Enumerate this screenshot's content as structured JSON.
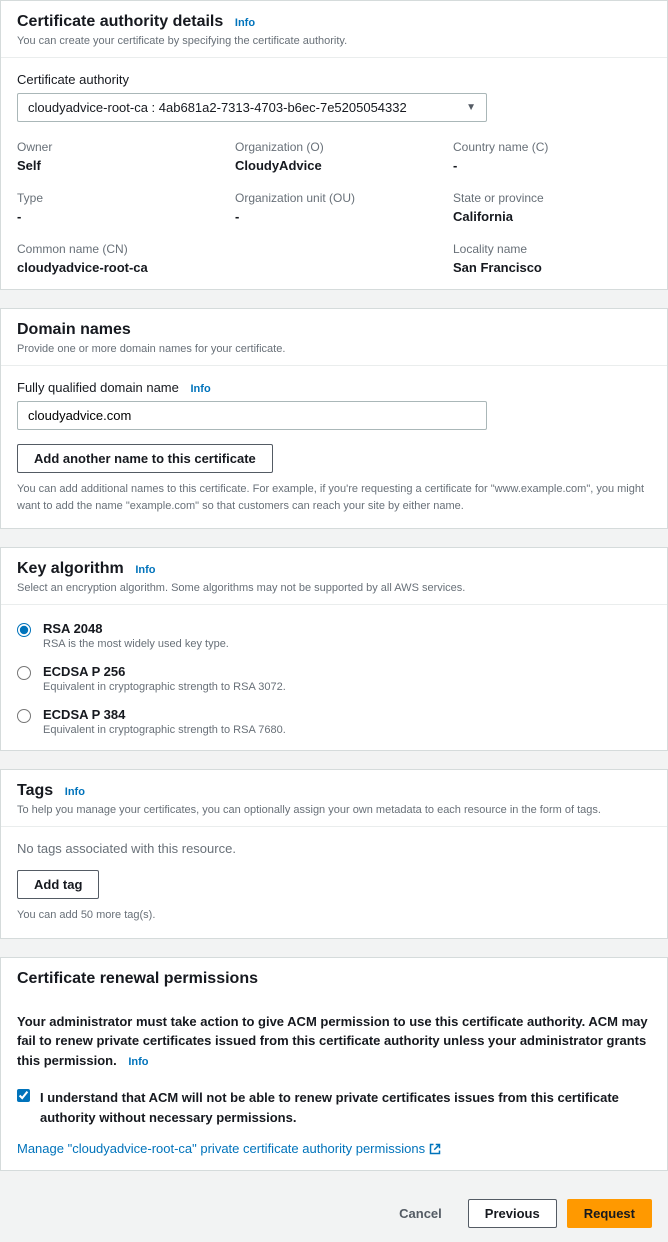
{
  "ca_details": {
    "title": "Certificate authority details",
    "info": "Info",
    "subtitle": "You can create your certificate by specifying the certificate authority.",
    "select_label": "Certificate authority",
    "select_value": "cloudyadvice-root-ca : 4ab681a2-7313-4703-b6ec-7e5205054332",
    "fields": {
      "owner_label": "Owner",
      "owner_value": "Self",
      "org_label": "Organization (O)",
      "org_value": "CloudyAdvice",
      "country_label": "Country name (C)",
      "country_value": "-",
      "type_label": "Type",
      "type_value": "-",
      "ou_label": "Organization unit (OU)",
      "ou_value": "-",
      "state_label": "State or province",
      "state_value": "California",
      "cn_label": "Common name (CN)",
      "cn_value": "cloudyadvice-root-ca",
      "locality_label": "Locality name",
      "locality_value": "San Francisco"
    }
  },
  "domain_names": {
    "title": "Domain names",
    "subtitle": "Provide one or more domain names for your certificate.",
    "fqdn_label": "Fully qualified domain name",
    "info": "Info",
    "fqdn_value": "cloudyadvice.com",
    "add_button": "Add another name to this certificate",
    "help": "You can add additional names to this certificate. For example, if you're requesting a certificate for \"www.example.com\", you might want to add the name \"example.com\" so that customers can reach your site by either name."
  },
  "key_algo": {
    "title": "Key algorithm",
    "info": "Info",
    "subtitle": "Select an encryption algorithm. Some algorithms may not be supported by all AWS services.",
    "options": [
      {
        "label": "RSA 2048",
        "desc": "RSA is the most widely used key type.",
        "checked": true
      },
      {
        "label": "ECDSA P 256",
        "desc": "Equivalent in cryptographic strength to RSA 3072.",
        "checked": false
      },
      {
        "label": "ECDSA P 384",
        "desc": "Equivalent in cryptographic strength to RSA 7680.",
        "checked": false
      }
    ]
  },
  "tags": {
    "title": "Tags",
    "info": "Info",
    "subtitle": "To help you manage your certificates, you can optionally assign your own metadata to each resource in the form of tags.",
    "empty": "No tags associated with this resource.",
    "add_button": "Add tag",
    "limit": "You can add 50 more tag(s)."
  },
  "renewal": {
    "title": "Certificate renewal permissions",
    "warning": "Your administrator must take action to give ACM permission to use this certificate authority. ACM may fail to renew private certificates issued from this certificate authority unless your administrator grants this permission.",
    "info": "Info",
    "checkbox_label": "I understand that ACM will not be able to renew private certificates issues from this certificate authority without necessary permissions.",
    "manage_link": "Manage \"cloudyadvice-root-ca\" private certificate authority permissions"
  },
  "footer": {
    "cancel": "Cancel",
    "previous": "Previous",
    "request": "Request"
  }
}
